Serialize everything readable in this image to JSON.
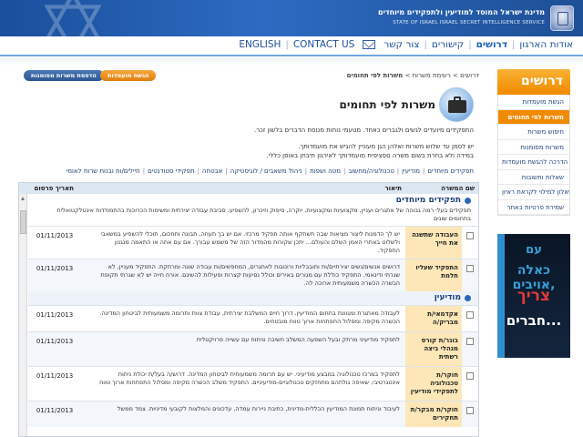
{
  "header": {
    "title_he": "מדינת ישראל המוסד למודיעין ולתפקידים מיוחדים",
    "title_en": "STATE OF ISRAEL  ISRAEL SECRET INTELLIGENCE SERVICE"
  },
  "nav": {
    "items": [
      {
        "label": "אודות הארגון",
        "active": false
      },
      {
        "label": "דרושים",
        "active": true
      },
      {
        "label": "קישורים",
        "active": false
      },
      {
        "label": "צור קשר",
        "active": false
      },
      {
        "label": "mail-icon",
        "icon": true
      },
      {
        "label": "CONTACT US",
        "active": false
      },
      {
        "label": "ENGLISH",
        "active": false
      }
    ]
  },
  "sidebar": {
    "title": "דרושים",
    "items": [
      {
        "label": "הגשת מועמדות",
        "active": false
      },
      {
        "label": "משרות לפי תחומים",
        "active": true
      },
      {
        "label": "חיפוש משרות",
        "active": false
      },
      {
        "label": "משרות מסומנות",
        "active": false
      },
      {
        "label": "הדרכה להגשת מועמדות",
        "active": false
      },
      {
        "label": "שאלות ותשובות",
        "active": false
      },
      {
        "label": "שאלון למילוי לקראת ראיון",
        "active": false
      },
      {
        "label": "שמירת פרטיות באתר",
        "active": false
      }
    ],
    "ad": {
      "line1": "עם",
      "line2": "כאלה אויבים,",
      "line3": "צריך",
      "line4": "חברים..."
    }
  },
  "main": {
    "breadcrumb": {
      "home": "דרושים",
      "list": "רשימת משרות",
      "current": "משרות לפי תחומים",
      "sep": ">"
    },
    "apply_button": "הגשת מועמדות",
    "marked_button": "הדפסת משרות מסומנות",
    "title": "משרות לפי תחומים",
    "intro1": "התפקידים מיועדים לנשים ולגברים כאחד. מטעמי נוחות מנוסח הדברים בלשון זכר.",
    "intro2": "יש לסמן עד שלוש משרות ואלהן הגן מעוניין להגיש את מועמדותך.",
    "intro3": "במידה ולא בחרת בשום משרה ספציפית מועמדותך לאירגון תיבחן באופן כללי.",
    "categories": [
      "תפקידים מיוחדים",
      "מודיעין",
      "טכנולוגיה/מחשוב",
      "מטה ושפות",
      "ניהול משאבים / לוגיסטיקה",
      "אבטחה",
      "תפקידי סטודנטים",
      "חיילים/ות ובנות שרות לאומי"
    ],
    "table": {
      "columns": [
        "שם המשרה",
        "תיאור",
        "תאריך פרסום"
      ],
      "sections": [
        {
          "title": "תפקידים מיוחדים",
          "desc": "תפקידים בעלי רמה גבוהה של אתגרים ועניין, מקצועיות ומקצועיות, יוקרה, סיפוק וזיכרון, להשפיע. סביבת עבודה יצירתית ומשימות הכרוכות בהתמודדות אינטלקטואלית בתחומים שונים",
          "rows": [
            {
              "name": "העבודה שתשנה את חייך",
              "desc": "יש לך הדמנות ליצור מציאות שבה תשתקף אותה תפקיד מרכזי. אם יש בך תעוזה, תבונה ותחכום, תוכלי להשפיע במשאבי ולשלוט באתרי האמן השלם והעולם... יתכן שקורות מהמדור הזה של משמש עבורך. אם עם אתה או התאמה מנגנון התפקיד.",
              "date": "01/11/2013"
            },
            {
              "name": "התפקיד שעליו חלמת",
              "desc": "דרושים אנשים/נשים יצירתיים/ות ותובבליות ורוטבות לאתגרים, המחפשים/ות עבודה שונה ומרתקת. התפקיד מעניין, לא שגרתי ודינאמי. התפקיד כוללת עם מגורים באירים וכולל נסיעות קצרות ופעילות להשיגם. אורח חייה יש לא שגרתי תקופת הכשרה הכשרה משמעותית ארוכה לה.",
              "date": "01/11/2013"
            }
          ]
        },
        {
          "title": "מודיעין",
          "desc": "",
          "rows": [
            {
              "name": "אקדמאי/ת מבריק/ה",
              "desc": "לעבודה מאתגרת ומגוונת בתחום המודיעין. דרוך חיים המשלבת יצירתית, עבודת צוות ותרומה משמעותית לביטחון המדינה. הכשרה מקיפה ומסלול התפתחות ארוך טווח מובטחים.",
              "date": "01/11/2013"
            },
            {
              "name": "בוגר/ת קורס מנהלי ביצה רשתית",
              "desc": "לתפקיד מודיעיני מרתק ובעל השפעה המשלב חשיבה וניתוח עם עשייה פרויקטלית",
              "date": "01/11/2013"
            },
            {
              "name": "חוקר/ת טכנולוגיה לתפקידי מודיעין",
              "desc": "לתפקיד במרכז טכנולוגיה במבצע מודיעיני. יש עם תרומה משמעותית לביטחון המדינה. דרוש/ה בעל/ת יכולת ניתוח אינטגרטיבי, שאיפה גולתהם מתחזקים טכנולוגיים-מודיעיניים. התפקיד משלב הכשרה מקיפה ומסלול התפתחות ארוך טווח",
              "date": "01/11/2013"
            },
            {
              "name": "חוקר/ת מבקר/ת תחקירים",
              "desc": "לעיבוד וניתוח תמונת המודיעין הכללית-מדינית, כתיבת ניירות עמדה, עדכונים והמלצות לקובעי מדיניות. צמד ממשל",
              "date": "01/11/2013"
            }
          ]
        }
      ]
    }
  }
}
